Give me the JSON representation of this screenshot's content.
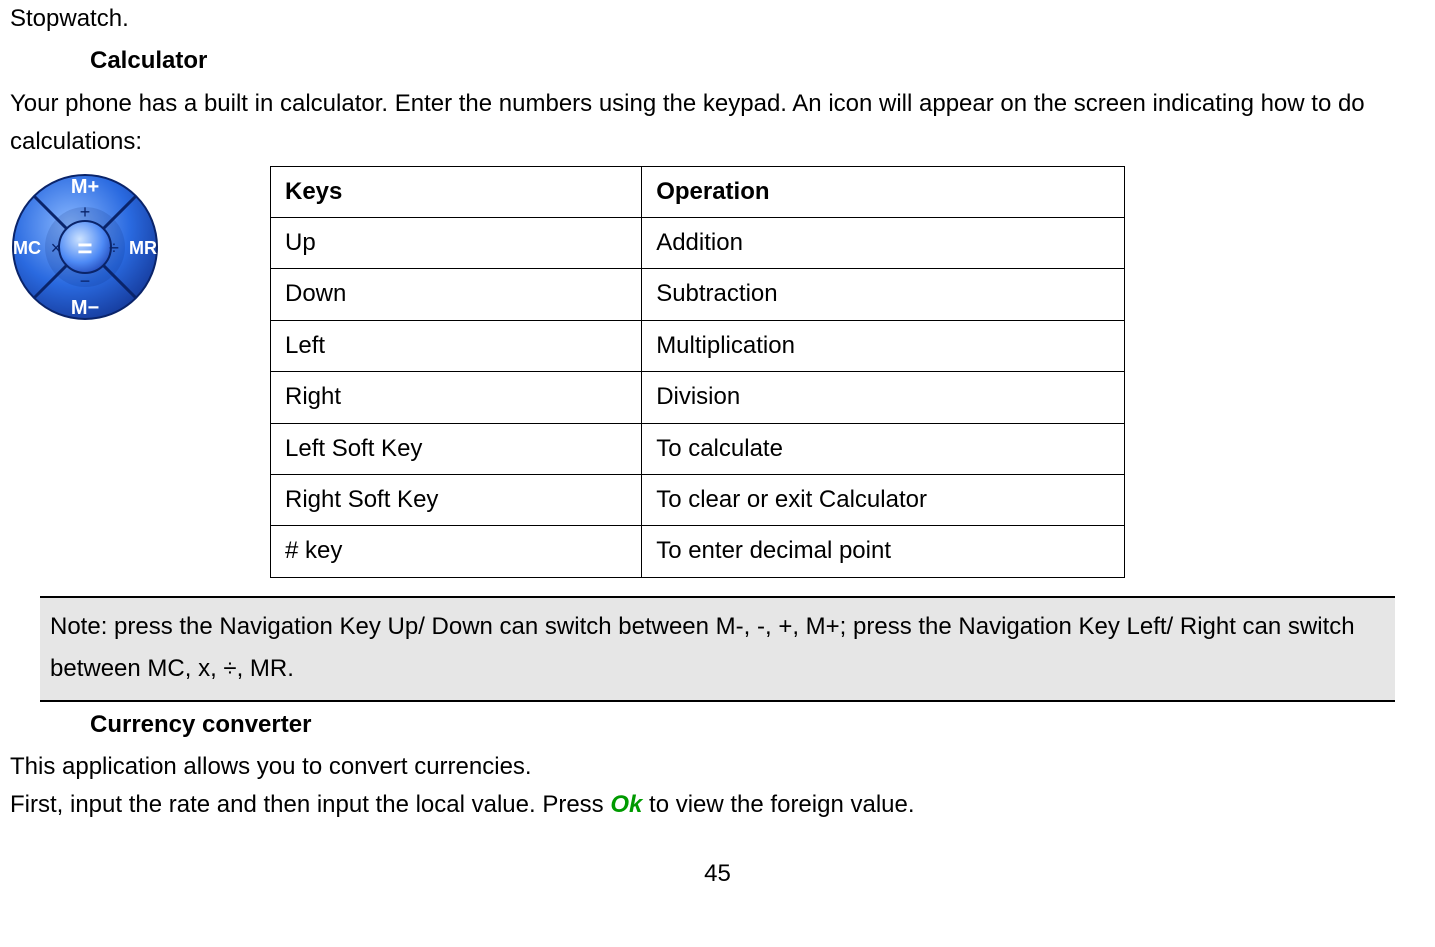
{
  "top_line": "Stopwatch.",
  "sections": {
    "calculator": {
      "heading": "Calculator",
      "intro": "Your phone has a built in calculator. Enter the numbers using the keypad. An icon will appear on the screen indicating how to do calculations:",
      "table": {
        "headers": {
          "keys": "Keys",
          "operation": "Operation"
        },
        "rows": [
          {
            "keys": "Up",
            "operation": "Addition"
          },
          {
            "keys": "Down",
            "operation": "Subtraction"
          },
          {
            "keys": "Left",
            "operation": "Multiplication"
          },
          {
            "keys": "Right",
            "operation": "Division"
          },
          {
            "keys": "Left Soft Key",
            "operation": "To calculate"
          },
          {
            "keys": "Right Soft Key",
            "operation": "To clear or exit Calculator"
          },
          {
            "keys": "# key",
            "operation": "To enter decimal point"
          }
        ]
      },
      "note": "Note: press the Navigation Key Up/ Down can switch between M-, -, +, M+; press the Navigation Key Left/ Right can switch between MC, x,  ÷, MR.",
      "keypad_labels": {
        "up": "M+",
        "up_inner": "+",
        "down": "M−",
        "down_inner": "−",
        "left": "MC",
        "left_inner": "×",
        "right": "MR",
        "right_inner": "÷",
        "center": "="
      }
    },
    "currency": {
      "heading": "Currency converter",
      "line1": "This application allows you to convert currencies.",
      "line2_before": "First, input the rate and then input the local value. Press ",
      "line2_ok": "Ok",
      "line2_after": " to view the foreign value."
    }
  },
  "page_number": "45"
}
